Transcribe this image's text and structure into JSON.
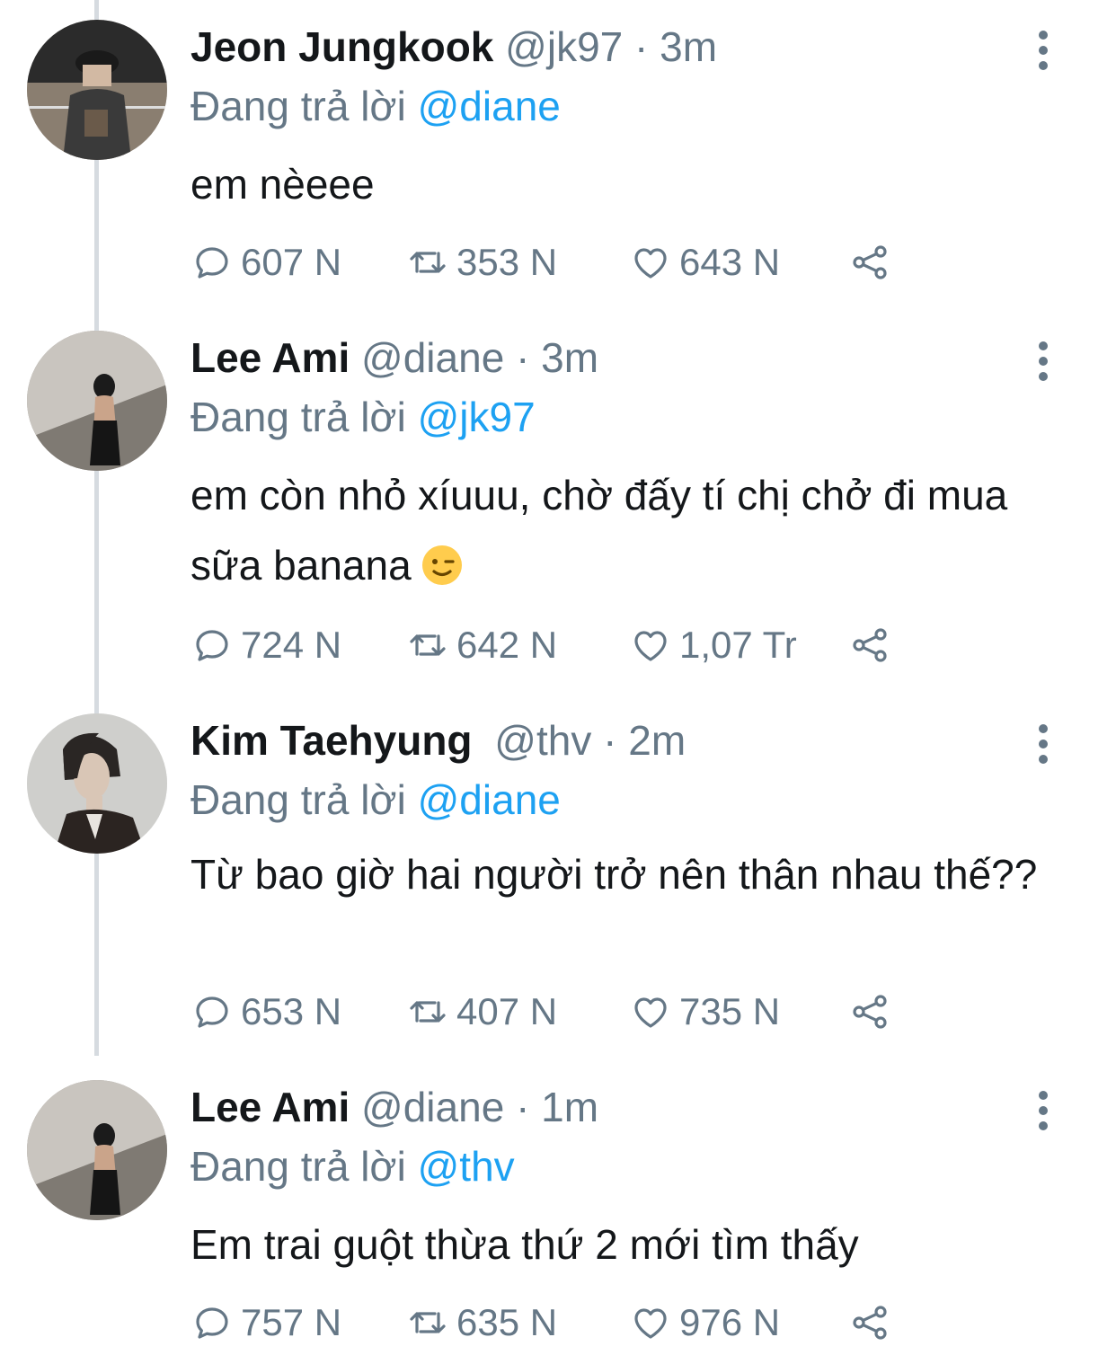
{
  "tweets": [
    {
      "name": "Jeon Jungkook",
      "handle": "@jk97",
      "time": "3m",
      "replying_prefix": "Đang trả lời",
      "replying_to": "@diane",
      "text": "em nèeee",
      "replies": "607 N",
      "retweets": "353 N",
      "likes": "643 N"
    },
    {
      "name": "Lee Ami",
      "handle": "@diane",
      "time": "3m",
      "replying_prefix": "Đang trả lời",
      "replying_to": "@jk97",
      "text": "em còn nhỏ xíuuu, chờ đấy tí chị chở đi mua sữa banana",
      "emoji": "winking-face",
      "replies": "724 N",
      "retweets": "642 N",
      "likes": "1,07 Tr"
    },
    {
      "name": "Kim Taehyung",
      "handle": "@thv",
      "time": "2m",
      "replying_prefix": "Đang trả lời",
      "replying_to": "@diane",
      "text": "Từ bao giờ hai người trở nên thân nhau thế??",
      "replies": "653 N",
      "retweets": "407 N",
      "likes": "735 N"
    },
    {
      "name": "Lee Ami",
      "handle": "@diane",
      "time": "1m",
      "replying_prefix": "Đang trả lời",
      "replying_to": "@thv",
      "text": "Em trai guột thừa thứ 2 mới tìm thấy",
      "replies": "757 N",
      "retweets": "635 N",
      "likes": "976 N"
    }
  ],
  "separator": "·",
  "colors": {
    "text": "#14171a",
    "secondary": "#657786",
    "accent": "#1da1f2",
    "thread_line": "#d6dbe0"
  },
  "icons": [
    "reply-icon",
    "retweet-icon",
    "like-icon",
    "share-icon",
    "more-icon"
  ]
}
